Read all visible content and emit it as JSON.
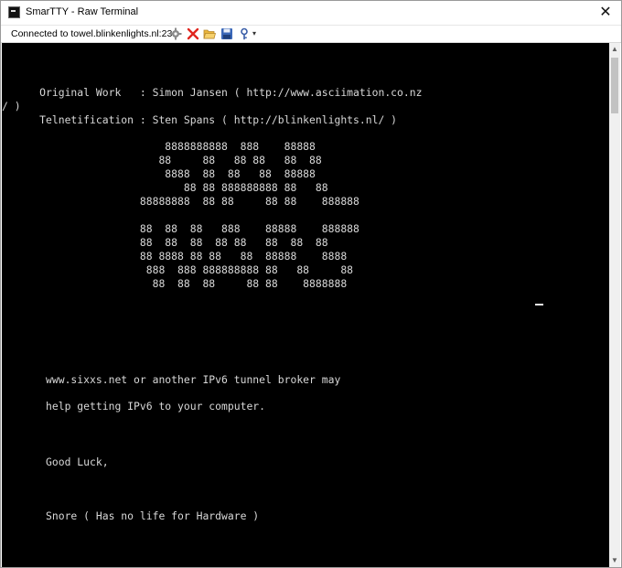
{
  "window": {
    "title": "SmarTTY - Raw Terminal",
    "close_glyph": "✕",
    "app_icon": "terminal-app-icon"
  },
  "toolbar": {
    "status": "Connected to towel.blinkenlights.nl:23",
    "icons": [
      "settings-icon",
      "disconnect-icon",
      "open-folder-icon",
      "save-icon",
      "key-dropdown-icon"
    ],
    "dropdown_glyph": "▾"
  },
  "scrollbar": {
    "up_glyph": "▲",
    "down_glyph": "▼"
  },
  "terminal": {
    "lines": [
      "      Original Work   : Simon Jansen ( http://www.asciimation.co.nz",
      "/ )",
      "      Telnetification : Sten Spans ( http://blinkenlights.nl/ )",
      "                          8888888888  888    88888",
      "                         88     88   88 88   88  88",
      "                          8888  88  88   88  88888",
      "                             88 88 888888888 88   88",
      "                      88888888  88 88     88 88    888888",
      "                      88  88  88   888    88888    888888",
      "                      88  88  88  88 88   88  88  88",
      "                      88 8888 88 88   88  88888    8888",
      "                       888  888 888888888 88   88     88",
      "                        88  88  88     88 88    8888888",
      "       www.sixxs.net or another IPv6 tunnel broker may",
      "       help getting IPv6 to your computer.",
      "       Good Luck,",
      "       Snore ( Has no life for Hardware )"
    ]
  }
}
